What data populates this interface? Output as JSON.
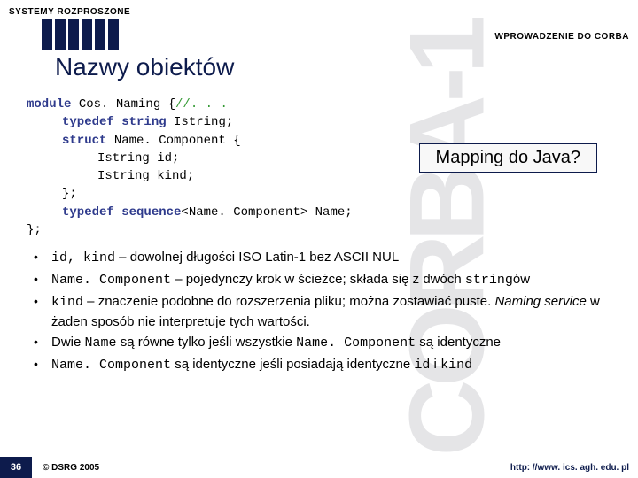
{
  "header": {
    "left": "SYSTEMY ROZPROSZONE",
    "right": "WPROWADZENIE DO CORBA"
  },
  "watermark": "CORBA-1",
  "title": "Nazwy obiektów",
  "code": {
    "l1a": "module ",
    "l1b": "Cos. Naming {",
    "l1c": "//. . .",
    "l2a": "typedef string ",
    "l2b": "Istring;",
    "l3a": "struct ",
    "l3b": "Name. Component {",
    "l4": "Istring id;",
    "l5": "Istring kind;",
    "l6": "};",
    "l7a": "typedef sequence",
    "l7b": "<Name. Component> Name;",
    "l8": "};"
  },
  "callout": "Mapping do Java?",
  "bullets": {
    "b1a": "id, kind",
    "b1b": " – dowolnej długości ISO Latin-1 bez ASCII NUL",
    "b2a": "Name. Component",
    "b2b": " – pojedynczy krok w ścieżce; składa się z dwóch ",
    "b2c": "string",
    "b2d": "ów",
    "b3a": "kind",
    "b3b": " – znaczenie podobne do rozszerzenia pliku; można zostawiać puste. ",
    "b3c": "Naming service",
    "b3d": " w żaden sposób nie interpretuje tych wartości.",
    "b4a": "Dwie ",
    "b4b": "Name",
    "b4c": " są równe tylko jeśli wszystkie ",
    "b4d": "Name. Component",
    "b4e": " są identyczne",
    "b5a": "Name. Component",
    "b5b": " są identyczne jeśli posiadają identyczne ",
    "b5c": "id",
    "b5d": " i ",
    "b5e": "kind"
  },
  "footer": {
    "page": "36",
    "copyright": "© DSRG 2005",
    "url": "http: //www. ics. agh. edu. pl"
  }
}
